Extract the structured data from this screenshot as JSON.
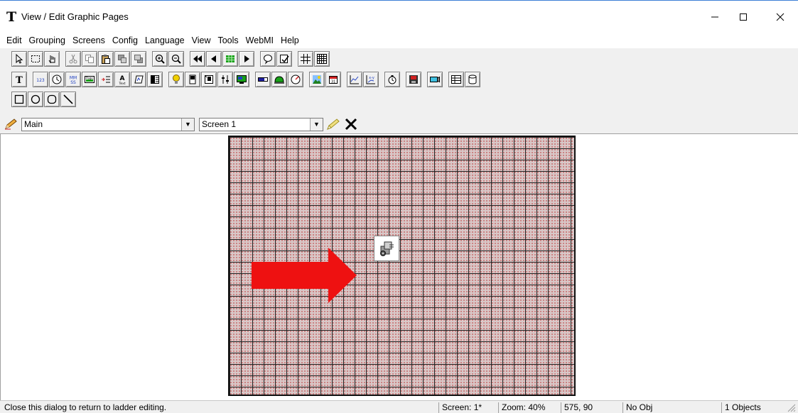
{
  "window": {
    "title": "View / Edit Graphic Pages",
    "app_icon_glyph": "T"
  },
  "menu": [
    "Edit",
    "Grouping",
    "Screens",
    "Config",
    "Language",
    "View",
    "Tools",
    "WebMI",
    "Help"
  ],
  "toolbar": {
    "row1": [
      "pointer-icon",
      "marquee-select-icon",
      "hand-pointer-icon",
      "cut-icon",
      "copy-icon",
      "paste-icon",
      "bring-front-icon",
      "send-back-icon",
      "zoom-in-icon",
      "zoom-out-icon",
      "first-screen-icon",
      "previous-screen-icon",
      "screen-grid-icon",
      "next-screen-icon",
      "tooltip-icon",
      "edit-property-icon",
      "grid-icon",
      "fine-grid-icon"
    ],
    "row2": [
      "text-tool-icon",
      "numeric-display-icon",
      "clock-icon",
      "time-display-icon",
      "page-button-icon",
      "list-icon",
      "text-label-icon",
      "bitmap-icon",
      "table-icon",
      "lamp-icon",
      "switch-icon",
      "selector-icon",
      "slider-icon",
      "monitor-icon",
      "bar-icon",
      "bezel-icon",
      "gauge-icon",
      "picture-icon",
      "calendar-icon",
      "trend-chart-icon",
      "xy-chart-icon",
      "timer-icon",
      "save-icon",
      "camera-icon",
      "data-table-icon",
      "tank-icon"
    ],
    "row3": [
      "rectangle-tool-icon",
      "ellipse-tool-icon",
      "rounded-rectangle-tool-icon",
      "line-tool-icon"
    ]
  },
  "selectors": {
    "page": {
      "value": "Main"
    },
    "screen": {
      "value": "Screen 1"
    }
  },
  "status": {
    "message": "Close this dialog to return to ladder editing.",
    "screen": "Screen: 1*",
    "zoom": "Zoom: 40%",
    "coords": "575, 90",
    "object": "No Obj",
    "count": "1 Objects"
  },
  "colors": {
    "arrow": "#ee1111",
    "canvas_grid": "#222222",
    "canvas_dots": "#c87070",
    "title_border": "#3c7fd6"
  }
}
